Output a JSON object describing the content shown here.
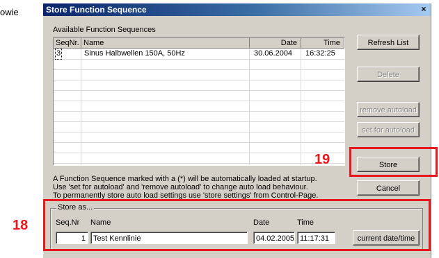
{
  "page": {
    "side_text": "owie",
    "annotation_19": "19",
    "annotation_18": "18"
  },
  "dialog": {
    "title": "Store Function Sequence",
    "close_glyph": "×"
  },
  "list": {
    "label": "Available Function Sequences",
    "columns": [
      "SeqNr.",
      "Name",
      "Date",
      "Time"
    ],
    "rows": [
      {
        "seq": "3",
        "name": "Sinus Halbwellen 150A, 50Hz",
        "date": "30.06.2004",
        "time": "16:32:25"
      }
    ]
  },
  "buttons": {
    "refresh": "Refresh List",
    "delete": "Delete",
    "remove_autoload": "remove autoload",
    "set_autoload": "set for autoload",
    "store": "Store",
    "cancel": "Cancel",
    "current_datetime": "current date/time"
  },
  "info": {
    "line1": "A Function Sequence marked with a (*) will be automatically loaded at startup.",
    "line2": "Use 'set for autoload' and 'remove autoload' to change auto load behaviour.",
    "line3": "To permanently store auto load settings use 'store settings' from Control-Page."
  },
  "store_as": {
    "group_label": "Store as...",
    "seq_label": "Seq.Nr",
    "name_label": "Name",
    "date_label": "Date",
    "time_label": "Time",
    "seq_value": "1",
    "name_value": "Test Kennlinie",
    "date_value": "04.02.2005",
    "time_value": "11:17:31"
  },
  "colors": {
    "annotation": "#e8181f",
    "title_bar": "#0a246a",
    "dialog_bg": "#d4d0c8"
  }
}
